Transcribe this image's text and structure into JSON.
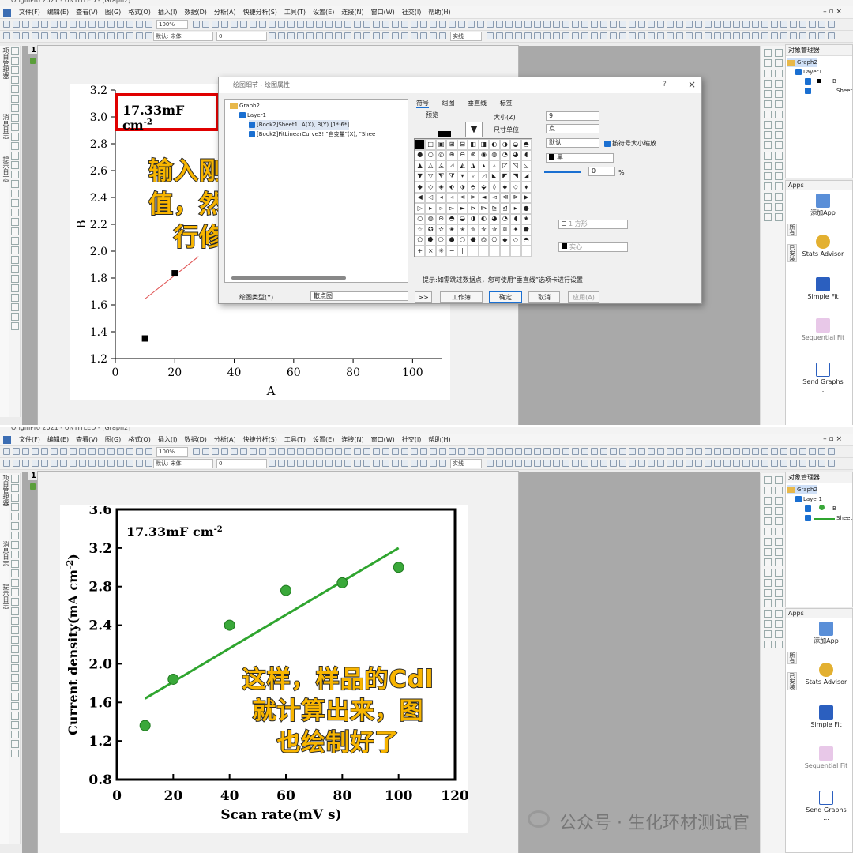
{
  "menu": [
    "文件(F)",
    "编辑(E)",
    "查看(V)",
    "图(G)",
    "格式(O)",
    "插入(I)",
    "数据(D)",
    "分析(A)",
    "快捷分析(S)",
    "工具(T)",
    "设置(E)",
    "连接(N)",
    "窗口(W)",
    "社交(I)",
    "帮助(H)"
  ],
  "toolbar": {
    "zoom": "100%",
    "font": "默认: 宋体",
    "font_size": "0",
    "line_style": "实线"
  },
  "left_labels": [
    "项目管理器",
    "消息日志",
    "提示日志"
  ],
  "graph_tab": "1",
  "object_manager": {
    "title": "对象管理器",
    "graph": "Graph2",
    "layer": "Layer1",
    "plot_b": "B",
    "plot_fit": "Sheet"
  },
  "apps": {
    "title": "Apps",
    "items": [
      {
        "label": "添加App",
        "icon": "add-app-icon"
      },
      {
        "label": "Stats Advisor",
        "icon": "wand-icon"
      },
      {
        "label": "Simple Fit",
        "icon": "simple-fit-icon"
      },
      {
        "label": "Sequential Fit",
        "icon": "sequential-fit-icon"
      },
      {
        "label": "Send Graphs ...",
        "icon": "send-graphs-icon"
      }
    ],
    "side_tabs": [
      "所有",
      "已安装"
    ]
  },
  "dialog": {
    "title": "绘图细节 - 绘图属性",
    "tree": [
      "Graph2",
      "Layer1",
      "[Book2]Sheet1! A(X), B(Y) [1*:6*]",
      "[Book2]FitLinearCurve3! \"自变量\"(X), \"Shee"
    ],
    "tabs": [
      "符号",
      "组图",
      "垂直线",
      "标签"
    ],
    "preview_label": "预览",
    "size_label": "大小(Z)",
    "size_value": "9",
    "unit_label": "尺寸单位",
    "unit_value": "点",
    "default_value": "默认",
    "scale_label": "按符号大小缩放",
    "color_value": "黑",
    "transparency": "0",
    "percent": "%",
    "shape_value": "1 方形",
    "fill_value": "实心",
    "hint": "提示:如需跳过数据点，您可使用“垂直线”选项卡进行设置",
    "plot_type_label": "绘图类型(Y)",
    "plot_type_value": "散点图",
    "buttons": {
      "expand": ">>",
      "workbook": "工作簿",
      "ok": "确定",
      "cancel": "取消",
      "apply": "应用(A)"
    }
  },
  "chart_top": {
    "chart_data": {
      "type": "scatter",
      "x": [
        10,
        20
      ],
      "y": [
        1.35,
        1.835
      ],
      "fit_line": {
        "x": [
          10,
          28
        ],
        "y": [
          1.645,
          1.96
        ]
      },
      "xlabel": "A",
      "ylabel": "B",
      "xlim": [
        0,
        110
      ],
      "ylim": [
        1.2,
        3.2
      ],
      "x_ticks": [
        "0",
        "20",
        "40",
        "60",
        "80",
        "100"
      ],
      "y_ticks": [
        "1.2",
        "1.4",
        "1.6",
        "1.8",
        "2.0",
        "2.2",
        "2.4",
        "2.6",
        "2.8",
        "3.0",
        "3.2"
      ],
      "annotation": "17.33mF cm"
    },
    "annotation_sup": "-2",
    "overlay_lines": [
      "输入刚刚的斜率",
      "值，然后对图进",
      "行修改美化"
    ]
  },
  "chart_bottom": {
    "chart_data": {
      "type": "scatter",
      "x": [
        10,
        20,
        40,
        60,
        80,
        100
      ],
      "y": [
        1.36,
        1.84,
        2.4,
        2.76,
        2.84,
        3.0
      ],
      "fit_line": {
        "x": [
          10,
          100
        ],
        "y": [
          1.64,
          3.2
        ]
      },
      "xlabel": "Scan rate(mV s)",
      "ylabel": "Current density(mA cm",
      "ylabel_sup": "-2",
      "ylabel_end": ")",
      "xlim": [
        0,
        120
      ],
      "ylim": [
        0.8,
        3.6
      ],
      "x_ticks": [
        "0",
        "20",
        "40",
        "60",
        "80",
        "100",
        "120"
      ],
      "y_ticks": [
        "0.8",
        "1.2",
        "1.6",
        "2.0",
        "2.4",
        "2.8",
        "3.2",
        "3.6"
      ],
      "annotation": "17.33mF cm",
      "marker_color": "#3aa83a",
      "line_color": "#2fa52f"
    },
    "annotation_sup": "-2",
    "overlay_lines": [
      "这样，样品的Cdl",
      "就计算出来，图",
      "也绘制好了"
    ]
  },
  "watermark": "公众号 · 生化环材测试官",
  "overlay_color": "#f8b500"
}
